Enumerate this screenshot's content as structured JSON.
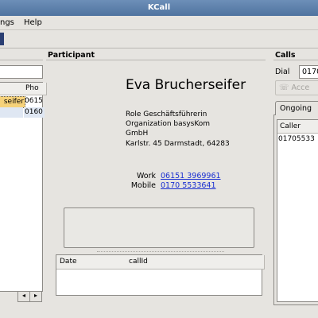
{
  "window": {
    "title": "KCall"
  },
  "menu": {
    "settings": "ngs",
    "help": "Help"
  },
  "sections": {
    "participant": "Participant",
    "calls": "Calls"
  },
  "left_table": {
    "columns": [
      "Pho"
    ],
    "rows": [
      {
        "name": "seifer",
        "phone": "0615",
        "selected": true
      },
      {
        "name": "",
        "phone": "0160",
        "selected": false
      }
    ]
  },
  "participant": {
    "name": "Eva Brucherseifer",
    "role": "Role Geschäftsführerin",
    "organization": "Organization basysKom",
    "org_suffix": "GmbH",
    "address": "Karlstr. 45 Darmstadt, 64283",
    "work_label": "Work",
    "work_number": "06151 3969961",
    "mobile_label": "Mobile",
    "mobile_number": "0170 5533641"
  },
  "history_table": {
    "columns": [
      "Date",
      "callId"
    ]
  },
  "calls": {
    "dial_label": "Dial",
    "dial_value": "0170",
    "accept_label": "Acce",
    "ongoing_tab": "Ongoing",
    "columns": [
      "Caller"
    ],
    "rows": [
      "01705533"
    ]
  },
  "icons": [
    "phone-accept-icon",
    "scroll-left-icon",
    "scroll-right-icon"
  ],
  "colors": {
    "titlebar": "#5a7ca8",
    "selection": "#f6d27a",
    "link": "#1a2fd1"
  }
}
